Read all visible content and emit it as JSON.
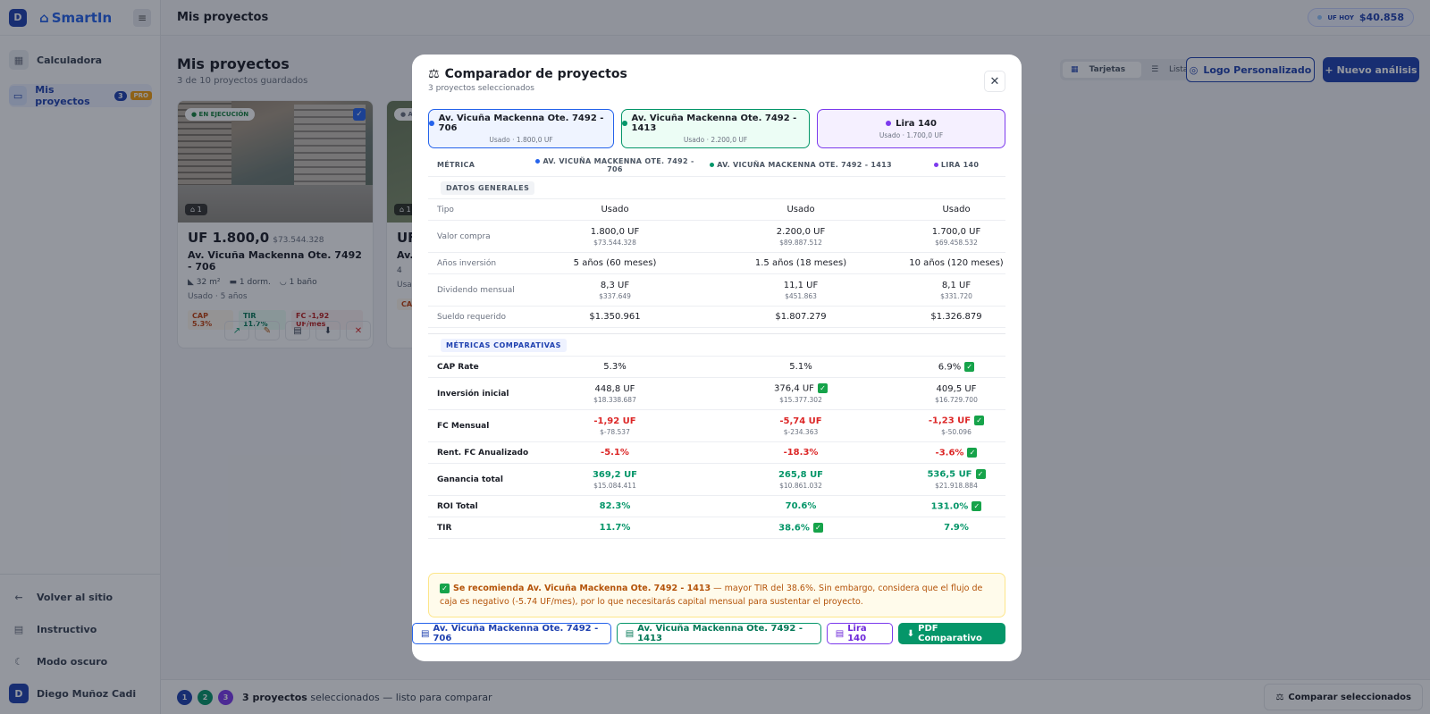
{
  "brand": {
    "initial": "D",
    "logo_text": "Smart",
    "logo_suffix": "In"
  },
  "sidebar": {
    "items": [
      {
        "label": "Calculadora",
        "icon": "calculator-icon"
      },
      {
        "label": "Mis proyectos",
        "icon": "folder-icon",
        "count": "3",
        "badge": "PRO"
      }
    ],
    "bottom": [
      {
        "label": "Volver al sitio",
        "icon": "arrow-left-icon"
      },
      {
        "label": "Instructivo",
        "icon": "book-icon"
      },
      {
        "label": "Modo oscuro",
        "icon": "moon-icon"
      }
    ],
    "user": {
      "initial": "D",
      "name": "Diego Muñoz Cadi"
    }
  },
  "topbar": {
    "title": "Mis proyectos",
    "uf_label": "UF HOY",
    "uf_value": "$40.858"
  },
  "page": {
    "title": "Mis proyectos",
    "subtitle": "3 de 10 proyectos guardados",
    "view_cards": "Tarjetas",
    "view_list": "Lista",
    "logo_button": "Logo Personalizado",
    "new_button": "+ Nuevo análisis"
  },
  "cards": [
    {
      "status": "EN EJECUCIÓN",
      "images": "1",
      "price": "UF 1.800,0",
      "price_clp": "$73.544.328",
      "name": "Av. Vicuña Mackenna Ote. 7492 - 706",
      "area": "32 m²",
      "rooms": "1 dorm.",
      "baths": "1 baño",
      "sub": "Usado · 5 años",
      "cap": "CAP 5.3%",
      "tir": "TIR 11.7%",
      "fc": "FC -1,92 UF/mes"
    },
    {
      "status": "A",
      "images": "1",
      "price": "UF",
      "name": "Av.",
      "area": "4",
      "sub": "Usa",
      "cap": "CA"
    }
  ],
  "modal": {
    "title": "Comparador de proyectos",
    "subtitle": "3 proyectos seleccionados",
    "projects": [
      {
        "name": "Av. Vicuña Mackenna Ote. 7492 - 706",
        "sub": "Usado · 1.800,0 UF",
        "color": "#2563eb",
        "bg": "#eff4ff"
      },
      {
        "name": "Av. Vicuña Mackenna Ote. 7492 - 1413",
        "sub": "Usado · 2.200,0 UF",
        "color": "#059669",
        "bg": "#ecfdf5"
      },
      {
        "name": "Lira 140",
        "sub": "Usado · 1.700,0 UF",
        "color": "#7c3aed",
        "bg": "#f5f0ff"
      }
    ],
    "headers": [
      "MÉTRICA",
      "AV. VICUÑA MACKENNA OTE. 7492 - 706",
      "AV. VICUÑA MACKENNA OTE. 7492 - 1413",
      "LIRA 140"
    ],
    "section_general": "DATOS GENERALES",
    "section_metrics": "MÉTRICAS COMPARATIVAS",
    "general": [
      {
        "label": "Tipo",
        "v": [
          "Usado",
          "Usado",
          "Usado"
        ]
      },
      {
        "label": "Valor compra",
        "v": [
          "1.800,0 UF",
          "2.200,0 UF",
          "1.700,0 UF"
        ],
        "s": [
          "$73.544.328",
          "$89.887.512",
          "$69.458.532"
        ]
      },
      {
        "label": "Años inversión",
        "v": [
          "5 años (60 meses)",
          "1.5 años (18 meses)",
          "10 años (120 meses)"
        ]
      },
      {
        "label": "Dividendo mensual",
        "v": [
          "8,3 UF",
          "11,1 UF",
          "8,1 UF"
        ],
        "s": [
          "$337.649",
          "$451.863",
          "$331.720"
        ]
      },
      {
        "label": "Sueldo requerido",
        "v": [
          "$1.350.961",
          "$1.807.279",
          "$1.326.879"
        ]
      }
    ],
    "metrics": [
      {
        "label": "CAP Rate",
        "v": [
          "5.3%",
          "5.1%",
          "6.9%"
        ],
        "best": 2,
        "tone": "plain"
      },
      {
        "label": "Inversión inicial",
        "v": [
          "448,8 UF",
          "376,4 UF",
          "409,5 UF"
        ],
        "s": [
          "$18.338.687",
          "$15.377.302",
          "$16.729.700"
        ],
        "best": 1,
        "tone": "plain"
      },
      {
        "label": "FC Mensual",
        "v": [
          "-1,92 UF",
          "-5,74 UF",
          "-1,23 UF"
        ],
        "s": [
          "$-78.537",
          "$-234.363",
          "$-50.096"
        ],
        "best": 2,
        "tone": "red"
      },
      {
        "label": "Rent. FC Anualizado",
        "v": [
          "-5.1%",
          "-18.3%",
          "-3.6%"
        ],
        "best": 2,
        "tone": "red"
      },
      {
        "label": "Ganancia total",
        "v": [
          "369,2 UF",
          "265,8 UF",
          "536,5 UF"
        ],
        "s": [
          "$15.084.411",
          "$10.861.032",
          "$21.918.884"
        ],
        "best": 2,
        "tone": "green"
      },
      {
        "label": "ROI Total",
        "v": [
          "82.3%",
          "70.6%",
          "131.0%"
        ],
        "best": 2,
        "tone": "green"
      },
      {
        "label": "TIR",
        "v": [
          "11.7%",
          "38.6%",
          "7.9%"
        ],
        "best": 1,
        "tone": "green"
      }
    ],
    "rec_lead": "Se recomienda Av. Vicuña Mackenna Ote. 7492 - 1413",
    "rec_text": " — mayor TIR del 38.6%. Sin embargo, considera que el flujo de caja es negativo (-5.74 UF/mes), por lo que necesitarás capital mensual para sustentar el proyecto.",
    "pdf_button": "PDF Comparativo"
  },
  "bottombar": {
    "count_bold": "3 proyectos",
    "text": " seleccionados — listo para comparar",
    "compare_button": "Comparar seleccionados",
    "dots": [
      "1",
      "2",
      "3"
    ]
  }
}
